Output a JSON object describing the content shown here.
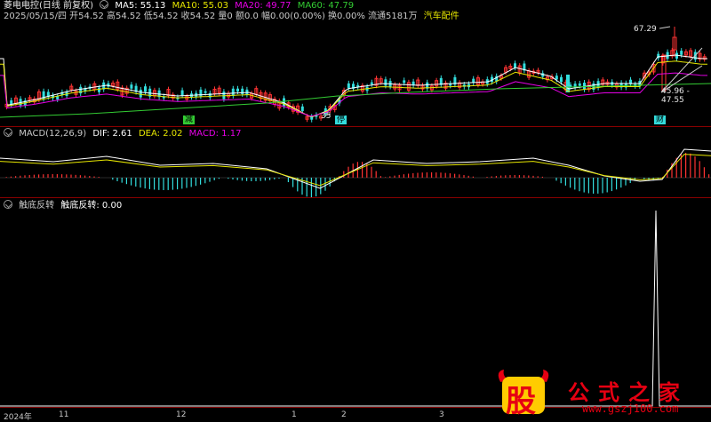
{
  "header": {
    "stock_name": "菱电电控(日线 前复权)",
    "ma5": "MA5: 55.13",
    "ma10": "MA10: 55.03",
    "ma20": "MA20: 49.77",
    "ma60": "MA60: 47.79",
    "info_line": "2025/05/15/四 开54.52 高54.52 低54.52 收54.52 量0 额0.0 幅0.00(0.00%) 换0.00% 流通5181万",
    "industry": "汽车配件"
  },
  "price_panel": {
    "high_label": "67.29",
    "low_label": "35",
    "right_label": "45.96 - 47.55",
    "tags": [
      "减",
      "停",
      "财"
    ]
  },
  "macd": {
    "title": "MACD(12,26,9)",
    "dif": "DIF: 2.61",
    "dea": "DEA: 2.02",
    "macd": "MACD: 1.17"
  },
  "indicator": {
    "title": "触底反转",
    "value_label": "触底反转: 0.00"
  },
  "xaxis": {
    "labels": [
      "2024年",
      "11",
      "12",
      "1",
      "2",
      "3"
    ]
  },
  "watermark": {
    "big": "股",
    "name": "公式之家",
    "url": "www.gszj100.com"
  },
  "colors": {
    "ma5": "#ffffff",
    "ma10": "#e6e600",
    "ma20": "#e600e6",
    "ma60": "#33cc33",
    "up": "#ff3333",
    "down": "#33dddd",
    "divider": "#8a0000"
  }
}
